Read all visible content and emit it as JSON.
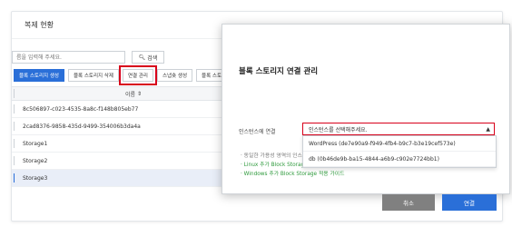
{
  "panel": {
    "title": "복제 현황"
  },
  "search": {
    "placeholder": "름을 입력해 주세요.",
    "button_label": "검색",
    "icon": "search-icon"
  },
  "toolbar": {
    "buttons": [
      {
        "label": "블록 스토리지 생성",
        "style": "primary"
      },
      {
        "label": "블록 스토리지 삭제",
        "style": "default"
      },
      {
        "label": "연결 관리",
        "style": "highlighted"
      },
      {
        "label": "스냅숏 생성",
        "style": "default"
      },
      {
        "label": "블록 스토리",
        "style": "default"
      }
    ]
  },
  "table": {
    "header": {
      "name": "이름",
      "sort_icon": "sort-icon"
    },
    "rows": [
      {
        "name": "8c506897-c023-4535-8a8c-f148b805eb77",
        "selected": false
      },
      {
        "name": "2cad8376-9858-435d-9499-354006b3da4a",
        "selected": false
      },
      {
        "name": "Storage1",
        "selected": false
      },
      {
        "name": "Storage2",
        "selected": false
      },
      {
        "name": "Storage3",
        "selected": true
      }
    ]
  },
  "dialog": {
    "title": "블록 스토리지 연결 관리",
    "instance_label": "인스턴스에 연결",
    "select_placeholder": "인스턴스를 선택해주세요.",
    "options": [
      "WordPress (de7e90a9-f949-4fb4-b9c7-b3e19cef573e)",
      "db (0b46de9b-ba15-4844-a6b9-c902e7724bb1)"
    ],
    "hint_note": "· 동일한 가용성 영역의 인스",
    "link_linux": "· Linux 추가 Block Storage 적용 가이드",
    "link_windows": "· Windows 추가 Block Storage 적용 가이드",
    "cancel_label": "취소",
    "connect_label": "연결"
  },
  "colors": {
    "primary": "#2a6fd8",
    "highlight_red": "#d8001b",
    "link_green": "#2e9a3c",
    "cancel_gray": "#808080"
  }
}
